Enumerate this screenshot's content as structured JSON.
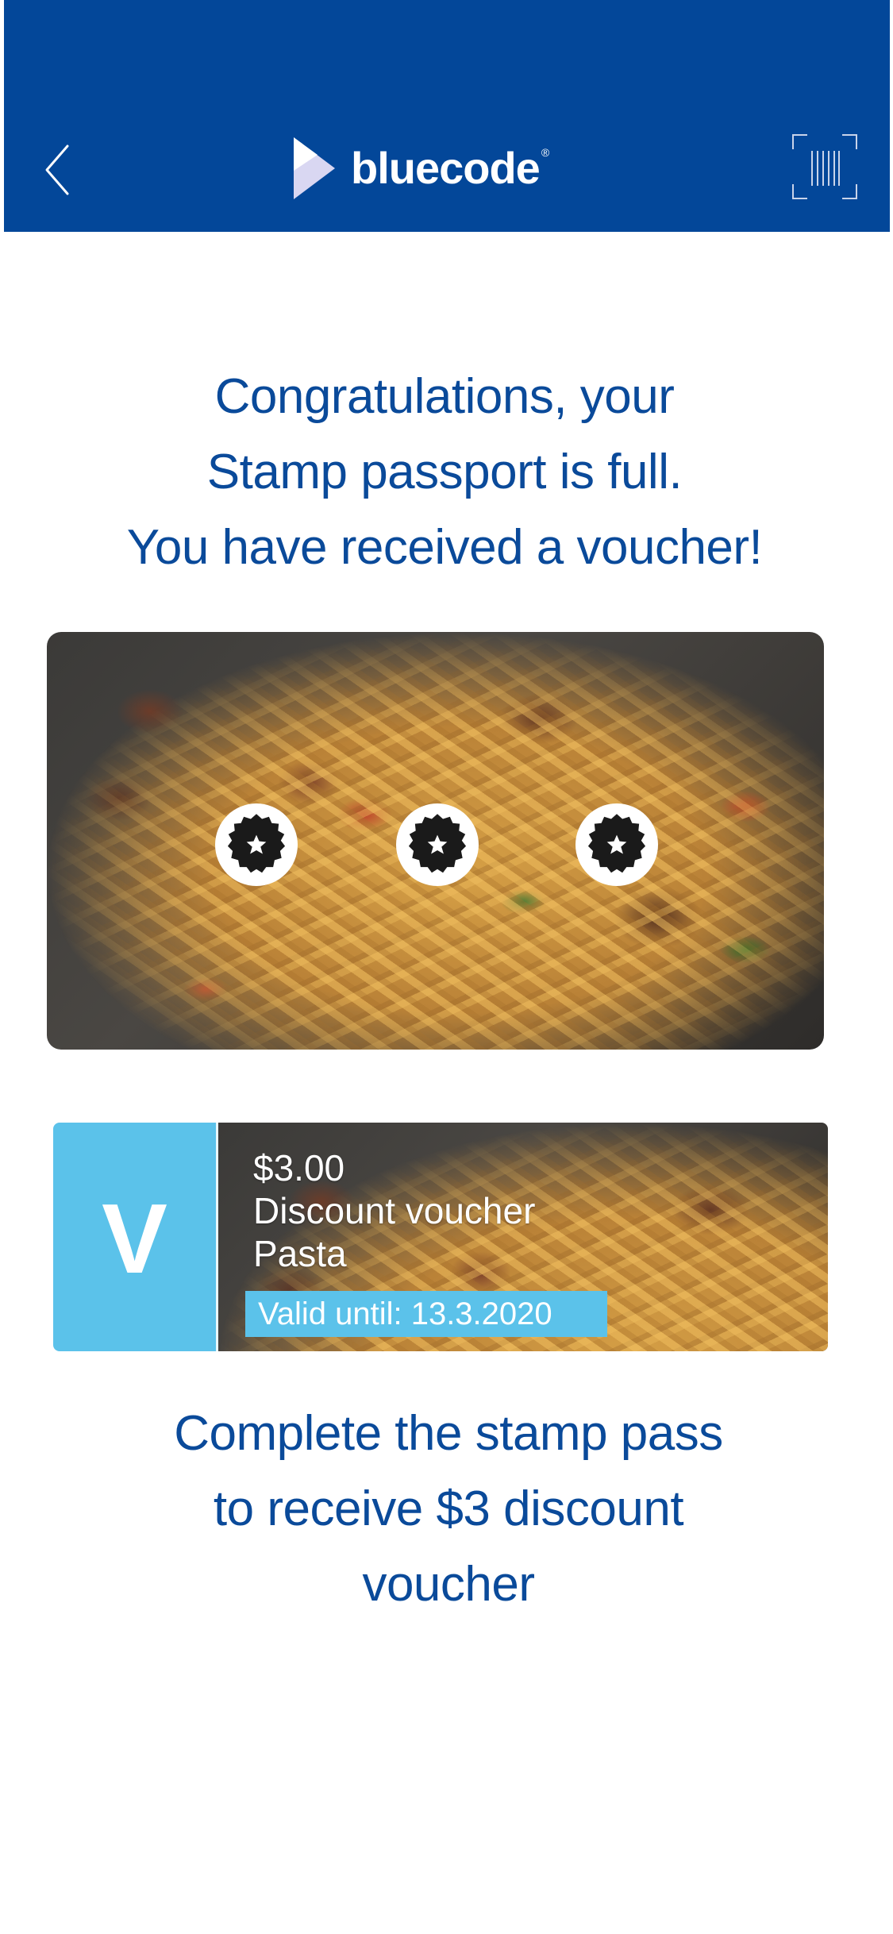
{
  "header": {
    "brand": "bluecode",
    "brand_mark": "®",
    "back_icon": "chevron-left-icon",
    "scan_icon": "barcode-scan-icon",
    "background_color": "#034799"
  },
  "headline": {
    "line1": "Congratulations, your",
    "line2": "Stamp passport is full.",
    "line3": "You have received a voucher!"
  },
  "stamp_card": {
    "stamps_collected": 3,
    "stamp_icon": "star-seal-icon"
  },
  "voucher": {
    "badge_letter": "V",
    "amount": "$3.00",
    "type": "Discount voucher",
    "product": "Pasta",
    "valid_until": "Valid until: 13.3.2020",
    "accent_color": "#5bc2ea"
  },
  "footer": {
    "line1": "Complete the stamp pass",
    "line2": "to receive $3 discount",
    "line3": "voucher"
  }
}
